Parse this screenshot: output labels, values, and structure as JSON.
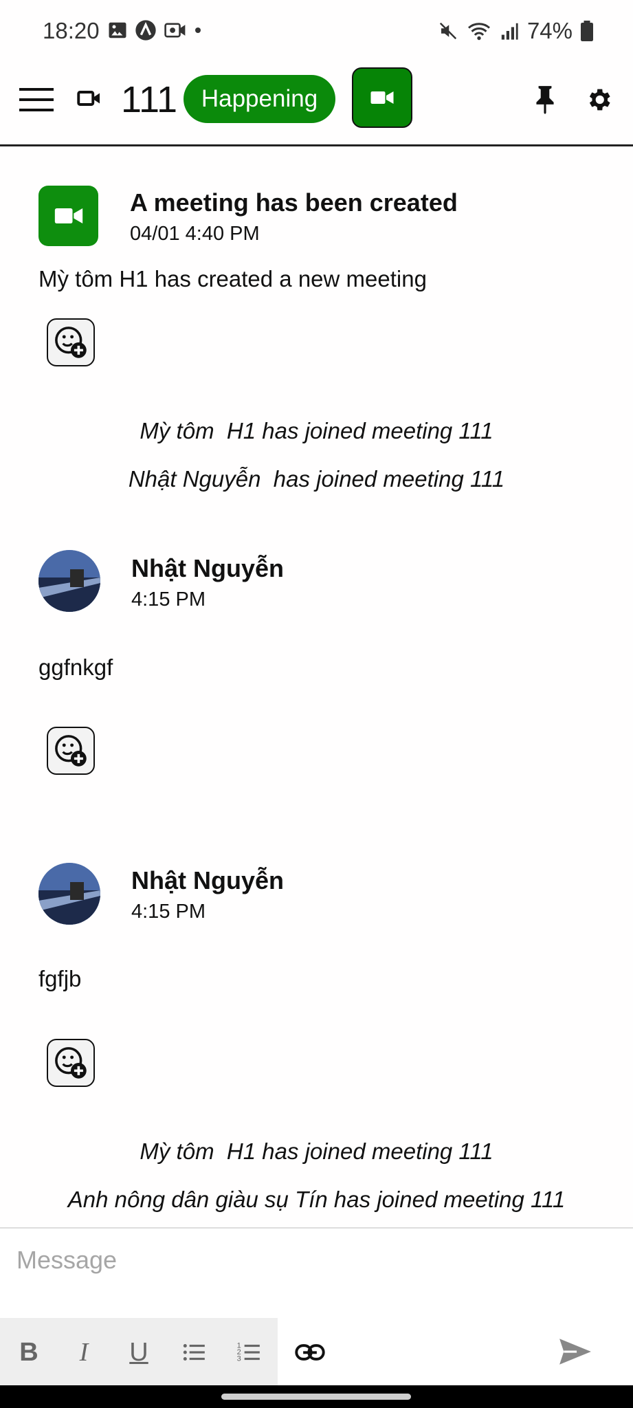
{
  "status": {
    "time": "18:20",
    "battery": "74%"
  },
  "header": {
    "title": "111",
    "status_label": "Happening"
  },
  "meeting_card": {
    "title": "A meeting has been created",
    "time": "04/01 4:40 PM",
    "text": "Mỳ tôm H1 has created a new meeting"
  },
  "system_messages_1": [
    "Mỳ tôm  H1 has joined meeting 111",
    "Nhật Nguyễn  has joined meeting 111"
  ],
  "messages": [
    {
      "author": "Nhật Nguyễn",
      "time": "4:15 PM",
      "text": "ggfnkgf"
    },
    {
      "author": "Nhật Nguyễn",
      "time": "4:15 PM",
      "text": "fgfjb"
    }
  ],
  "system_messages_2": [
    "Mỳ tôm  H1 has joined meeting 111",
    "Anh nông dân giàu sụ Tín has joined meeting 111"
  ],
  "composer": {
    "placeholder": "Message",
    "toolbar": {
      "bold": "B",
      "italic": "I",
      "underline": "U"
    }
  },
  "colors": {
    "accent_green": "#0b8a0b"
  },
  "icons": [
    "menu-icon",
    "video-camera-icon",
    "pin-icon",
    "gear-icon",
    "add-reaction-icon",
    "link-icon",
    "send-icon"
  ]
}
